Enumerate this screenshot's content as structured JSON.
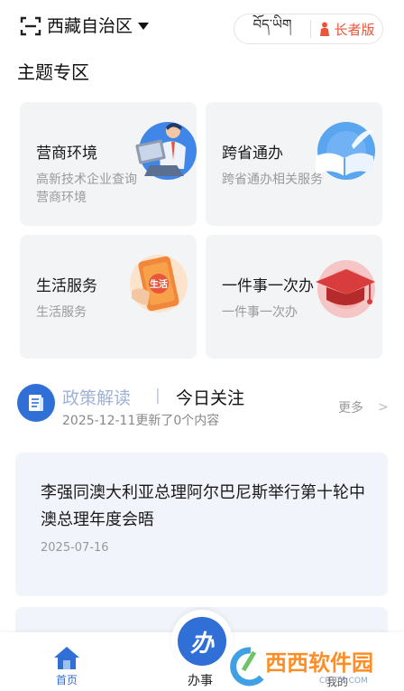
{
  "header": {
    "region": "西藏自治区",
    "tibetan_label": "བོད་ཡིག",
    "elder_label": "长者版"
  },
  "theme_section": {
    "title": "主题专区",
    "cards": [
      {
        "title": "营商环境",
        "desc": "高新技术企业查询营商环境",
        "icon": "business-person-icon"
      },
      {
        "title": "跨省通办",
        "desc": "跨省通办相关服务",
        "icon": "open-book-icon"
      },
      {
        "title": "生活服务",
        "desc": "生活服务",
        "icon": "phone-life-icon",
        "badge": "生活"
      },
      {
        "title": "一件事一次办",
        "desc": "一件事一次办",
        "icon": "graduation-cap-icon"
      }
    ]
  },
  "policy": {
    "tab_policy": "政策解读",
    "separator": "|",
    "tab_today": "今日关注",
    "update_text": "2025-12-11更新了0个内容",
    "more": "更多",
    "more_arrow": ">"
  },
  "news": [
    {
      "title": "李强同澳大利亚总理阿尔巴尼斯举行第十轮中澳总理年度会晤",
      "date": "2025-07-16"
    }
  ],
  "bottom_nav": {
    "home": "首页",
    "center": "办事",
    "center_glyph": "办",
    "mine": "我的"
  },
  "watermark": {
    "text": "西西软件园",
    "sub": "CR173.COM"
  },
  "colors": {
    "accent": "#2f6fd6",
    "elder": "#e8573c",
    "card_bg": "#f3f4f6",
    "news_bg": "#f1f4fa"
  }
}
